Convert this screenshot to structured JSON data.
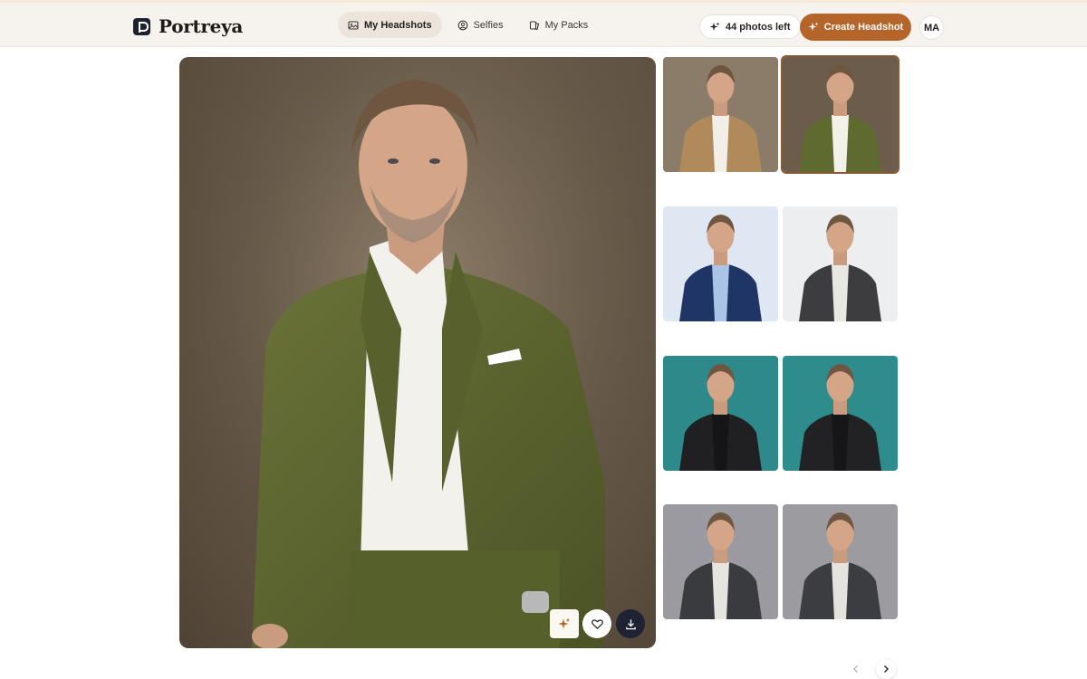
{
  "brand": {
    "name": "Portreya",
    "logo_icon": "portreya-logo-icon"
  },
  "nav": {
    "items": [
      {
        "label": "My Headshots",
        "icon": "image-icon",
        "active": true
      },
      {
        "label": "Selfies",
        "icon": "face-icon",
        "active": false
      },
      {
        "label": "My Packs",
        "icon": "packs-icon",
        "active": false
      }
    ]
  },
  "header": {
    "photos_left": "44 photos left",
    "create_label": "Create Headshot",
    "avatar_initials": "MA"
  },
  "colors": {
    "accent": "#b5652a",
    "dark": "#1f2233",
    "header_bg": "#f6f3ef"
  },
  "main_photo": {
    "actions": [
      {
        "name": "enhance",
        "icon": "sparkle-icon"
      },
      {
        "name": "favorite",
        "icon": "heart-icon"
      },
      {
        "name": "download",
        "icon": "download-icon"
      }
    ]
  },
  "thumbnails": [
    {
      "background": "#8a7c68",
      "suit": "#b08a5a",
      "shirt": "#f2efe8",
      "selected": false
    },
    {
      "background": "#6b5c4b",
      "suit": "#5e6a30",
      "shirt": "#f4f1ea",
      "selected": true
    },
    {
      "background": "#dfe8f2",
      "suit": "#1f3566",
      "shirt": "#a9c4e4",
      "selected": false
    },
    {
      "background": "#eceef0",
      "suit": "#3d3d3f",
      "shirt": "#e9e7e2",
      "selected": false
    },
    {
      "background": "#2e8a8a",
      "suit": "#202022",
      "shirt": "#151517",
      "selected": false
    },
    {
      "background": "#2f8c8c",
      "suit": "#222224",
      "shirt": "#161618",
      "selected": false
    },
    {
      "background": "#9a9aa0",
      "suit": "#3a3b3e",
      "shirt": "#e6e4df",
      "selected": false
    },
    {
      "background": "#9c9b9f",
      "suit": "#3c3d40",
      "shirt": "#e5e3de",
      "selected": false
    }
  ],
  "pagination": {
    "prev_icon": "chevron-left-icon",
    "next_icon": "chevron-right-icon"
  }
}
